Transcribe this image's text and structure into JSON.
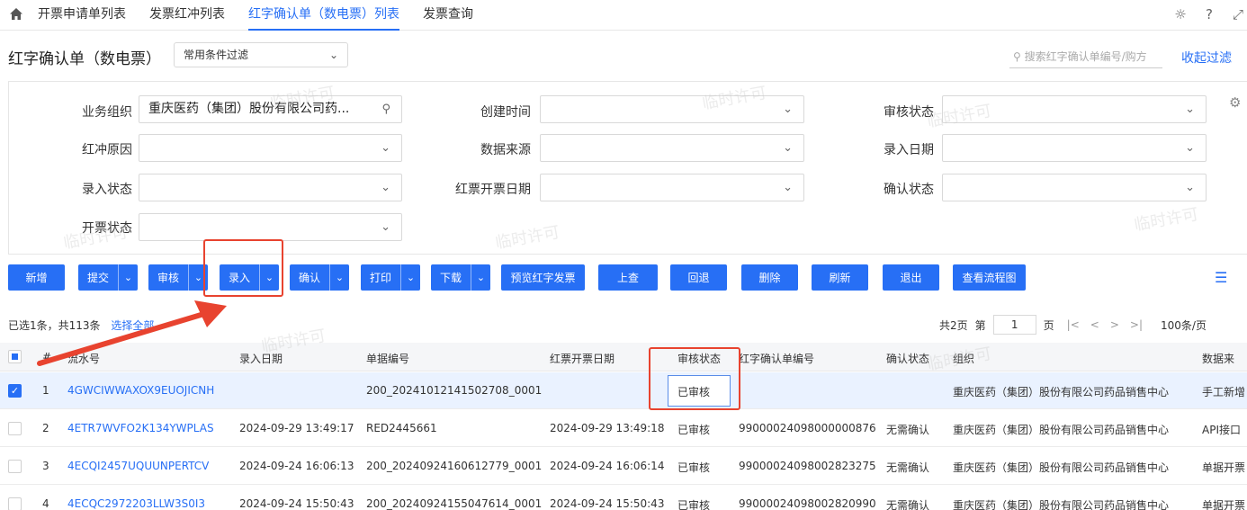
{
  "nav": {
    "tabs": [
      "开票申请单列表",
      "发票红冲列表",
      "红字确认单（数电票）列表",
      "发票查询"
    ],
    "active_tab": 2
  },
  "header": {
    "title": "红字确认单（数电票）",
    "filter_select": "常用条件过滤",
    "search_placeholder": "搜索红字确认单编号/购方",
    "collapse_label": "收起过滤"
  },
  "filters": {
    "org_label": "业务组织",
    "org_value": "重庆医药（集团）股份有限公司药...",
    "created_label": "创建时间",
    "audit_label": "审核状态",
    "reason_label": "红冲原因",
    "source_label": "数据来源",
    "entry_date_label": "录入日期",
    "entry_status_label": "录入状态",
    "red_date_label": "红票开票日期",
    "confirm_label": "确认状态",
    "invoice_status_label": "开票状态"
  },
  "toolbar": {
    "add": "新增",
    "submit": "提交",
    "audit": "审核",
    "entry": "录入",
    "confirm": "确认",
    "print": "打印",
    "download": "下载",
    "preview": "预览红字发票",
    "lookup": "上查",
    "rollback": "回退",
    "delete": "删除",
    "refresh": "刷新",
    "exit": "退出",
    "flow": "查看流程图"
  },
  "selection": {
    "info": "已选1条，共113条",
    "select_all": "选择全部"
  },
  "pager": {
    "total_pages": "共2页",
    "page_prefix": "第",
    "current": "1",
    "page_suffix": "页",
    "page_size": "100条/页"
  },
  "table": {
    "headers": [
      "#",
      "流水号",
      "录入日期",
      "单据编号",
      "红票开票日期",
      "审核状态",
      "红字确认单编号",
      "确认状态",
      "组织",
      "数据来"
    ],
    "rows": [
      [
        "1",
        "4GWCIWWAXOX9EUOJICNH",
        "",
        "200_20241012141502708_0001",
        "",
        "已审核",
        "",
        "",
        "重庆医药（集团）股份有限公司药品销售中心",
        "手工新增"
      ],
      [
        "2",
        "4ETR7WVFO2K134YWPLAS",
        "2024-09-29 13:49:17",
        "RED2445661",
        "2024-09-29 13:49:18",
        "已审核",
        "99000024098000000876",
        "无需确认",
        "重庆医药（集团）股份有限公司药品销售中心",
        "API接口"
      ],
      [
        "3",
        "4ECQI2457UQUUNPERTCV",
        "2024-09-24 16:06:13",
        "200_20240924160612779_0001",
        "2024-09-24 16:06:14",
        "已审核",
        "99000024098002823275",
        "无需确认",
        "重庆医药（集团）股份有限公司药品销售中心",
        "单据开票"
      ],
      [
        "4",
        "4ECQC2972203LLW3S0I3",
        "2024-09-24 15:50:43",
        "200_20240924155047614_0001",
        "2024-09-24 15:50:43",
        "已审核",
        "99000024098002820990",
        "无需确认",
        "重庆医药（集团）股份有限公司药品销售中心",
        "单据开票"
      ]
    ]
  },
  "watermark": "临时许可",
  "colors": {
    "accent": "#276ff5",
    "annotation": "#e8432f"
  }
}
